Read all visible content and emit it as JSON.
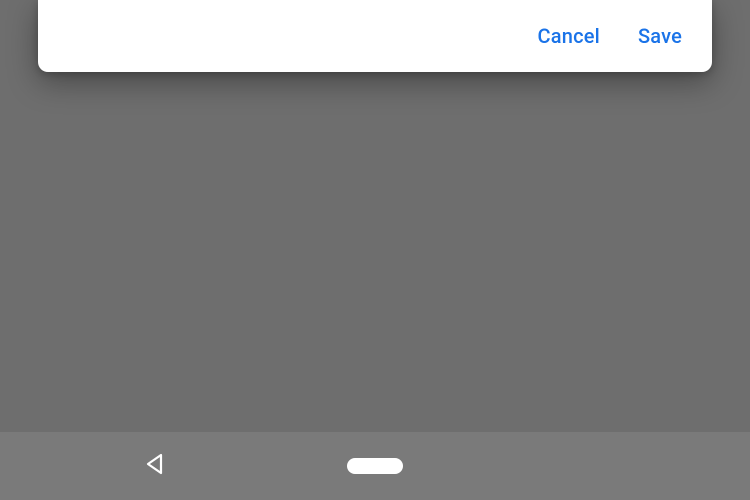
{
  "dialog": {
    "cancel_label": "Cancel",
    "save_label": "Save"
  },
  "colors": {
    "accent": "#1a73e8",
    "dialog_bg": "#ffffff",
    "backdrop": "#6e6e6e",
    "navbar": "#7a7a7a"
  }
}
